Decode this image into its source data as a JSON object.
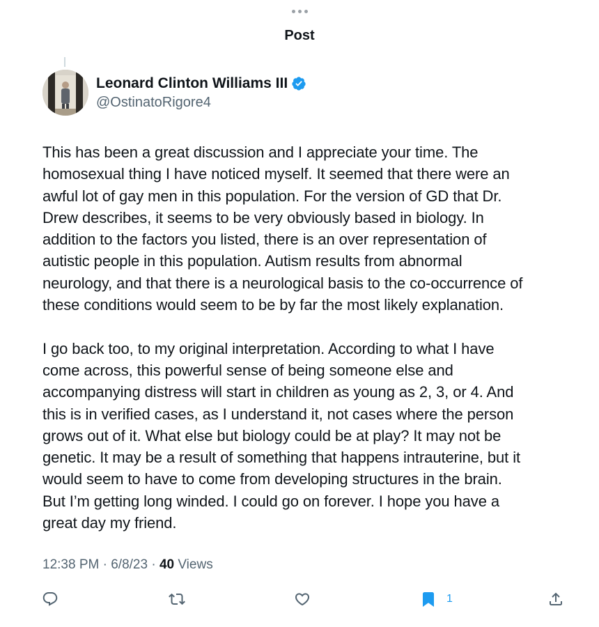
{
  "header": {
    "title": "Post"
  },
  "author": {
    "display_name": "Leonard Clinton Williams III",
    "handle": "@OstinatoRigore4",
    "verified": true
  },
  "tweet": {
    "paragraphs": [
      "This has been a great discussion and I appreciate your time. The\nhomosexual thing I have noticed myself. It seemed that there were an\nawful lot of gay men in this population. For the version of GD that Dr.\nDrew describes, it seems to be very obviously based in biology.  In\naddition to the factors you listed, there is an over representation of\nautistic people in this population. Autism results from abnormal\nneurology, and that there is a neurological basis to the co-occurrence of\nthese conditions would seem to be by far the most likely explanation.",
      "I go back too, to my original interpretation. According to what I have\ncome across, this powerful sense of being someone else and\naccompanying distress will start in children as young as 2, 3, or 4. And\nthis is in verified cases, as I understand it, not cases where the person\ngrows out of it. What else but biology could be at play? It may not be\ngenetic. It may be a result of something that happens intrauterine, but it\nwould seem to have to come from developing structures in the brain.\nBut I’m getting long winded. I could go on forever. I hope you have a\ngreat day my friend."
    ]
  },
  "meta": {
    "time": "12:38 PM",
    "separator": " · ",
    "date": "6/8/23",
    "views_count": "40",
    "views_label": " Views"
  },
  "actions": {
    "reply_icon": "reply-icon",
    "retweet_icon": "retweet-icon",
    "like_icon": "heart-icon",
    "bookmark_icon": "bookmark-icon",
    "bookmark_count": "1",
    "share_icon": "share-icon"
  },
  "colors": {
    "accent": "#1d9bf0",
    "text_primary": "#0f1419",
    "text_secondary": "#536471"
  }
}
